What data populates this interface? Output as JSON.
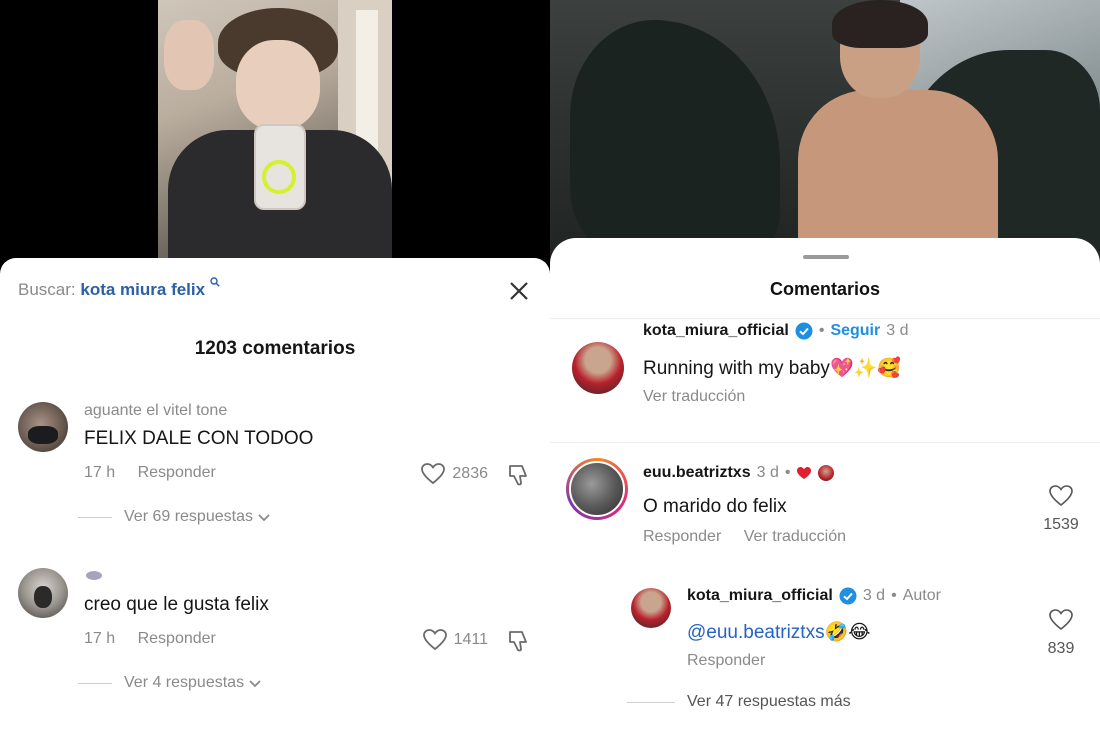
{
  "left": {
    "search_prefix": "Buscar:",
    "search_query": "kota miura felix",
    "comment_count": "1203 comentarios",
    "comments": [
      {
        "username": "aguante el vitel tone",
        "text": "FELIX DALE CON TODOO",
        "time": "17 h",
        "reply_label": "Responder",
        "likes": "2836",
        "more_replies": "Ver 69 respuestas"
      },
      {
        "username": "",
        "text": "creo que le gusta felix",
        "time": "17 h",
        "reply_label": "Responder",
        "likes": "1411",
        "more_replies": "Ver 4 respuestas"
      }
    ]
  },
  "right": {
    "title": "Comentarios",
    "caption": {
      "username": "kota_miura_official",
      "follow_label": "Seguir",
      "time": "3 d",
      "text": "Running with my baby",
      "text_emojis": "💖✨🥰",
      "translate_label": "Ver traducción"
    },
    "comments": [
      {
        "username": "euu.beatriztxs",
        "time": "3 d",
        "text": "O marido do felix",
        "reply_label": "Responder",
        "translate_label": "Ver traducción",
        "likes": "1539"
      }
    ],
    "reply": {
      "username": "kota_miura_official",
      "time": "3 d",
      "author_label": "Autor",
      "mention": "@euu.beatriztxs",
      "text_emojis": "🤣😂",
      "reply_label": "Responder",
      "likes": "839",
      "more_replies": "Ver 47 respuestas más"
    }
  },
  "colors": {
    "link_blue": "#2b5fa8",
    "follow_blue": "#1f8fe0",
    "verified_blue": "#1f8fe0",
    "muted_gray": "#8a8a8a",
    "story_ring": [
      "#f58529",
      "#dd2a7b",
      "#8134af"
    ]
  },
  "icons": [
    "search-icon",
    "close-icon",
    "heart-icon",
    "dislike-icon",
    "chevron-down-icon",
    "verified-icon",
    "red-heart-icon"
  ]
}
